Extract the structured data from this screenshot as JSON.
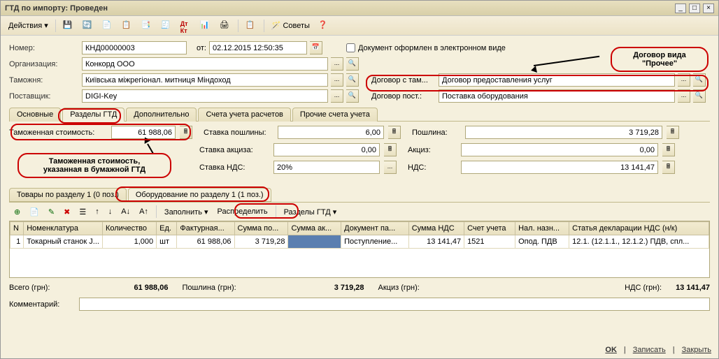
{
  "window": {
    "title": "ГТД по импорту: Проведен"
  },
  "toolbar": {
    "actions": "Действия",
    "help": "Советы"
  },
  "header": {
    "number_label": "Номер:",
    "number": "КНД00000003",
    "from_label": "от:",
    "date": "02.12.2015 12:50:35",
    "electronic_label": "Документ оформлен в электронном виде",
    "org_label": "Организация:",
    "org": "Конкорд ООО",
    "customs_label": "Таможня:",
    "customs": "Київська міжрегіонал. митниця Міндоход",
    "supplier_label": "Поставщик:",
    "supplier": "DIGI-Key",
    "contract_customs_label": "Договор с там...",
    "contract_customs": "Договор предоставления услуг",
    "contract_supplier_label": "Договор пост.:",
    "contract_supplier": "Поставка оборудования"
  },
  "tabs": {
    "t1": "Основные",
    "t2": "Разделы ГТД",
    "t3": "Дополнительно",
    "t4": "Счета учета расчетов",
    "t5": "Прочие счета учета"
  },
  "fields": {
    "customs_value_label": "Таможенная стоимость:",
    "customs_value": "61 988,06",
    "duty_rate_label": "Ставка пошлины:",
    "duty_rate": "6,00",
    "duty_label": "Пошлина:",
    "duty": "3 719,28",
    "excise_rate_label": "Ставка акциза:",
    "excise_rate": "0,00",
    "excise_label": "Акциз:",
    "excise": "0,00",
    "vat_rate_label": "Ставка НДС:",
    "vat_rate": "20%",
    "vat_label": "НДС:",
    "vat": "13 141,47"
  },
  "subtabs": {
    "s1": "Товары по разделу 1 (0 поз.)",
    "s2": "Оборудование по разделу 1 (1 поз.)"
  },
  "subtoolbar": {
    "fill": "Заполнить",
    "distribute": "Распределить",
    "sections": "Разделы ГТД"
  },
  "grid": {
    "headers": {
      "n": "N",
      "nom": "Номенклатура",
      "qty": "Количество",
      "unit": "Ед.",
      "invoice": "Фактурная...",
      "duty_sum": "Сумма по...",
      "excise_sum": "Сумма ак...",
      "doc": "Документ па...",
      "vat_sum": "Сумма НДС",
      "acct": "Счет учета",
      "tax": "Нал. назн...",
      "decl": "Статья декларации НДС (н/к)"
    },
    "rows": [
      {
        "n": "1",
        "nom": "Токарный станок J...",
        "qty": "1,000",
        "unit": "шт",
        "invoice": "61 988,06",
        "duty_sum": "3 719,28",
        "excise_sum": "",
        "doc": "Поступление...",
        "vat_sum": "13 141,47",
        "acct": "1521",
        "tax": "Опод. ПДВ",
        "decl": "12.1. (12.1.1., 12.1.2.) ПДВ, спл..."
      }
    ]
  },
  "totals": {
    "total_label": "Всего (грн):",
    "total": "61 988,06",
    "duty_label": "Пошлина (грн):",
    "duty": "3 719,28",
    "excise_label": "Акциз (грн):",
    "excise": "",
    "vat_label": "НДС (грн):",
    "vat": "13 141,47"
  },
  "comment_label": "Комментарий:",
  "buttons": {
    "ok": "OK",
    "save": "Записать",
    "close": "Закрыть"
  },
  "callouts": {
    "c1": "Договор вида\n\"Прочее\"",
    "c2": "Таможенная стоимость,\nуказанная в бумажной ГТД"
  }
}
